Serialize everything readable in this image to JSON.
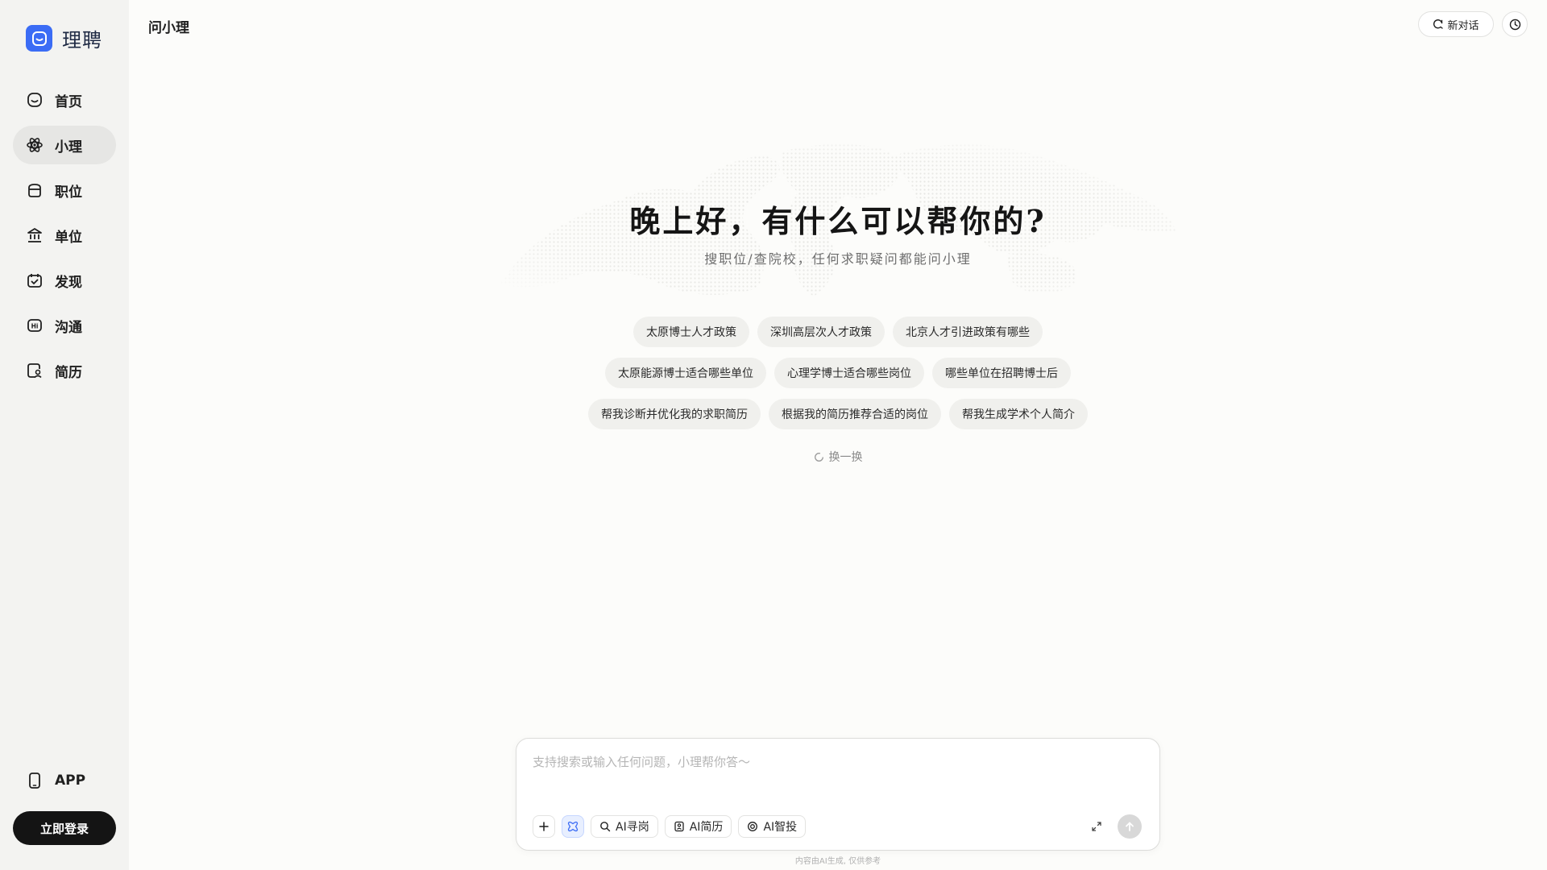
{
  "brand": {
    "name": "理聘",
    "color": "#3b6cf5"
  },
  "sidebar": {
    "items": [
      {
        "label": "首页",
        "icon": "home-icon",
        "active": false
      },
      {
        "label": "小理",
        "icon": "atom-icon",
        "active": true
      },
      {
        "label": "职位",
        "icon": "briefcase-icon",
        "active": false
      },
      {
        "label": "单位",
        "icon": "institution-icon",
        "active": false
      },
      {
        "label": "发现",
        "icon": "calendar-check-icon",
        "active": false
      },
      {
        "label": "沟通",
        "icon": "hi-chat-icon",
        "active": false
      },
      {
        "label": "简历",
        "icon": "resume-user-icon",
        "active": false
      }
    ],
    "app_label": "APP",
    "login_label": "立即登录"
  },
  "header": {
    "title": "问小理",
    "new_chat_label": "新对话"
  },
  "hero": {
    "greeting": "晚上好，有什么可以帮你的?",
    "subtitle": "搜职位/查院校，任何求职疑问都能问小理"
  },
  "suggestions": {
    "rows": [
      [
        "太原博士人才政策",
        "深圳高层次人才政策",
        "北京人才引进政策有哪些"
      ],
      [
        "太原能源博士适合哪些单位",
        "心理学博士适合哪些岗位",
        "哪些单位在招聘博士后"
      ],
      [
        "帮我诊断并优化我的求职简历",
        "根据我的简历推荐合适的岗位",
        "帮我生成学术个人简介"
      ]
    ],
    "refresh_label": "换一换"
  },
  "composer": {
    "placeholder": "支持搜索或输入任何问题，小理帮你答～",
    "tools": [
      "AI寻岗",
      "AI简历",
      "AI智投"
    ],
    "disclaimer": "内容由AI生成, 仅供参考"
  }
}
